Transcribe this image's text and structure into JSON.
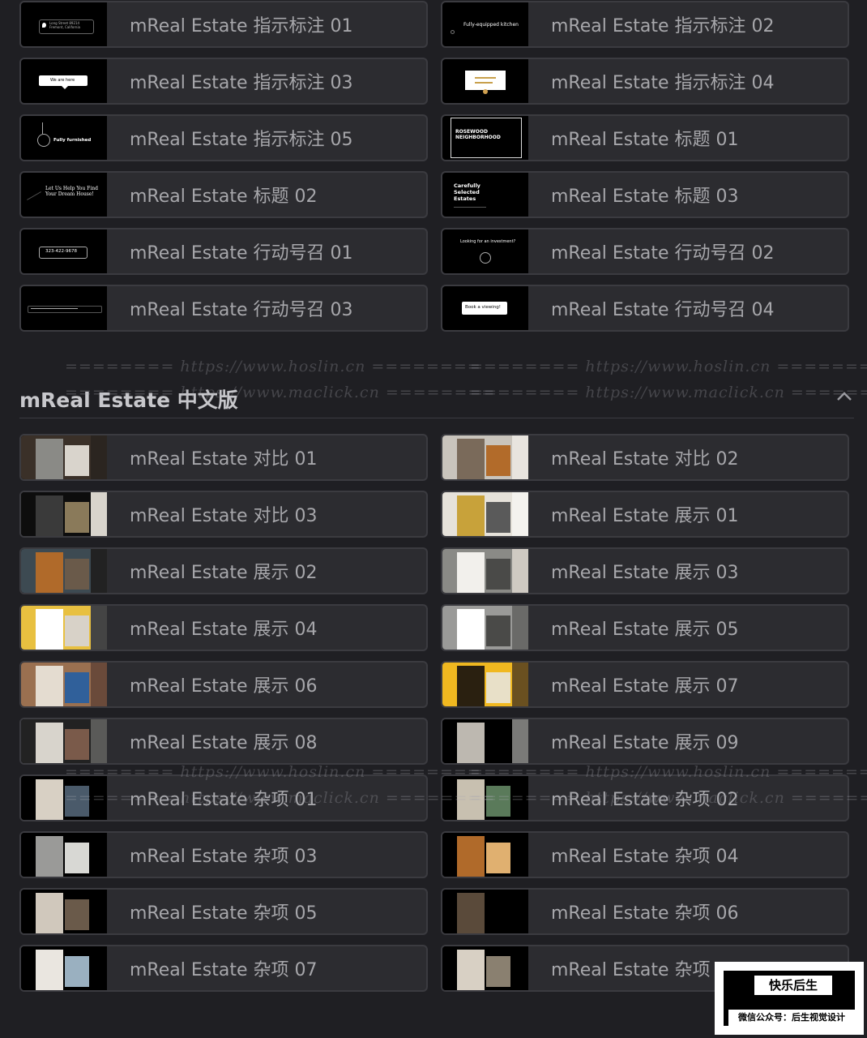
{
  "section": {
    "title": "mReal Estate 中文版"
  },
  "top_items": [
    {
      "label": "mReal Estate 指示标注 01",
      "thumb_text": "Long Street 89214 Fremont, California"
    },
    {
      "label": "mReal Estate 指示标注 02",
      "thumb_text": "Fully-equipped kitchen"
    },
    {
      "label": "mReal Estate 指示标注 03",
      "thumb_text": "We are here"
    },
    {
      "label": "mReal Estate 指示标注 04",
      "thumb_text": ""
    },
    {
      "label": "mReal Estate 指示标注 05",
      "thumb_text": "Fully furnished"
    },
    {
      "label": "mReal Estate 标题 01",
      "thumb_text": "ROSEWOOD NEIGHBORHOOD"
    },
    {
      "label": "mReal Estate 标题 02",
      "thumb_text": "Let Us Help You Find Your Dream House!"
    },
    {
      "label": "mReal Estate 标题 03",
      "thumb_text": "Carefully Selected Estates"
    },
    {
      "label": "mReal Estate 行动号召 01",
      "thumb_text": "323-422-9678"
    },
    {
      "label": "mReal Estate 行动号召 02",
      "thumb_text": "Looking for an investment?"
    },
    {
      "label": "mReal Estate 行动号召 03",
      "thumb_text": ""
    },
    {
      "label": "mReal Estate 行动号召 04",
      "thumb_text": "Book a viewing!"
    }
  ],
  "bottom_items": [
    {
      "label": "mReal Estate 对比 01"
    },
    {
      "label": "mReal Estate 对比 02"
    },
    {
      "label": "mReal Estate 对比 03"
    },
    {
      "label": "mReal Estate 展示 01"
    },
    {
      "label": "mReal Estate 展示 02"
    },
    {
      "label": "mReal Estate 展示 03"
    },
    {
      "label": "mReal Estate 展示 04"
    },
    {
      "label": "mReal Estate 展示 05"
    },
    {
      "label": "mReal Estate 展示 06"
    },
    {
      "label": "mReal Estate 展示 07"
    },
    {
      "label": "mReal Estate 展示 08"
    },
    {
      "label": "mReal Estate 展示 09"
    },
    {
      "label": "mReal Estate 杂项 01"
    },
    {
      "label": "mReal Estate 杂项 02"
    },
    {
      "label": "mReal Estate 杂项 03"
    },
    {
      "label": "mReal Estate 杂项 04"
    },
    {
      "label": "mReal Estate 杂项 05"
    },
    {
      "label": "mReal Estate 杂项 06"
    },
    {
      "label": "mReal Estate 杂项 07"
    },
    {
      "label": "mReal Estate 杂项 08"
    }
  ],
  "watermarks": {
    "hoslin": "======== https://www.hoslin.cn ========",
    "maclick": "======== https://www.maclick.cn ========"
  },
  "stamp": {
    "title": "快乐后生",
    "subtitle": "微信公众号：后生视觉设计"
  },
  "icons": {
    "collapse": "chevron-up-icon"
  },
  "colors": {
    "background": "#1f1f23",
    "item_bg": "#2c2c30",
    "item_border": "#3b3b40",
    "label": "#a7a7ab"
  }
}
